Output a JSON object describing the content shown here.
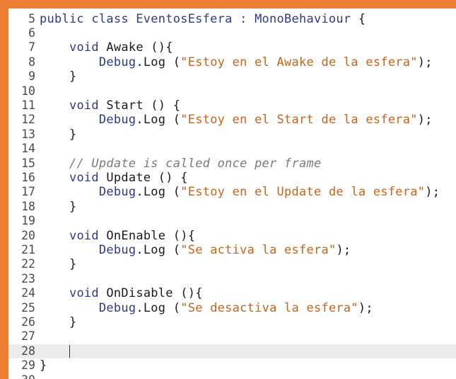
{
  "colors": {
    "border": "#ed7d31",
    "background": "#ffffff",
    "keyword": "#2b3a8c",
    "string": "#c7641b",
    "comment": "#7a7a7a",
    "current_line": "#ececec"
  },
  "editor": {
    "current_line": 28,
    "lines": [
      {
        "num": "5",
        "tokens": [
          {
            "t": "public class EventosEsfera : ",
            "c": "kw"
          },
          {
            "t": "MonoBehaviour",
            "c": "ty"
          },
          {
            "t": " {",
            "c": ""
          }
        ]
      },
      {
        "num": "6",
        "tokens": []
      },
      {
        "num": "7",
        "tokens": [
          {
            "t": "    ",
            "c": ""
          },
          {
            "t": "void",
            "c": "kw"
          },
          {
            "t": " Awake (){",
            "c": ""
          }
        ]
      },
      {
        "num": "8",
        "tokens": [
          {
            "t": "        ",
            "c": ""
          },
          {
            "t": "Debug",
            "c": "ty"
          },
          {
            "t": ".Log (",
            "c": ""
          },
          {
            "t": "\"Estoy en el Awake de la esfera\"",
            "c": "str"
          },
          {
            "t": ");",
            "c": ""
          }
        ]
      },
      {
        "num": "9",
        "tokens": [
          {
            "t": "    }",
            "c": ""
          }
        ]
      },
      {
        "num": "10",
        "tokens": []
      },
      {
        "num": "11",
        "tokens": [
          {
            "t": "    ",
            "c": ""
          },
          {
            "t": "void",
            "c": "kw"
          },
          {
            "t": " Start () {",
            "c": ""
          }
        ]
      },
      {
        "num": "12",
        "tokens": [
          {
            "t": "        ",
            "c": ""
          },
          {
            "t": "Debug",
            "c": "ty"
          },
          {
            "t": ".Log (",
            "c": ""
          },
          {
            "t": "\"Estoy en el Start de la esfera\"",
            "c": "str"
          },
          {
            "t": ");",
            "c": ""
          }
        ]
      },
      {
        "num": "13",
        "tokens": [
          {
            "t": "    }",
            "c": ""
          }
        ]
      },
      {
        "num": "14",
        "tokens": []
      },
      {
        "num": "15",
        "tokens": [
          {
            "t": "    ",
            "c": ""
          },
          {
            "t": "// Update is called once per frame",
            "c": "com"
          }
        ]
      },
      {
        "num": "16",
        "tokens": [
          {
            "t": "    ",
            "c": ""
          },
          {
            "t": "void",
            "c": "kw"
          },
          {
            "t": " Update () {",
            "c": ""
          }
        ]
      },
      {
        "num": "17",
        "tokens": [
          {
            "t": "        ",
            "c": ""
          },
          {
            "t": "Debug",
            "c": "ty"
          },
          {
            "t": ".Log (",
            "c": ""
          },
          {
            "t": "\"Estoy en el Update de la esfera\"",
            "c": "str"
          },
          {
            "t": ");",
            "c": ""
          }
        ]
      },
      {
        "num": "18",
        "tokens": [
          {
            "t": "    }",
            "c": ""
          }
        ]
      },
      {
        "num": "19",
        "tokens": []
      },
      {
        "num": "20",
        "tokens": [
          {
            "t": "    ",
            "c": ""
          },
          {
            "t": "void",
            "c": "kw"
          },
          {
            "t": " OnEnable (){",
            "c": ""
          }
        ]
      },
      {
        "num": "21",
        "tokens": [
          {
            "t": "        ",
            "c": ""
          },
          {
            "t": "Debug",
            "c": "ty"
          },
          {
            "t": ".Log (",
            "c": ""
          },
          {
            "t": "\"Se activa la esfera\"",
            "c": "str"
          },
          {
            "t": ");",
            "c": ""
          }
        ]
      },
      {
        "num": "22",
        "tokens": [
          {
            "t": "    }",
            "c": ""
          }
        ]
      },
      {
        "num": "23",
        "tokens": []
      },
      {
        "num": "24",
        "tokens": [
          {
            "t": "    ",
            "c": ""
          },
          {
            "t": "void",
            "c": "kw"
          },
          {
            "t": " OnDisable (){",
            "c": ""
          }
        ]
      },
      {
        "num": "25",
        "tokens": [
          {
            "t": "        ",
            "c": ""
          },
          {
            "t": "Debug",
            "c": "ty"
          },
          {
            "t": ".Log (",
            "c": ""
          },
          {
            "t": "\"Se desactiva la esfera\"",
            "c": "str"
          },
          {
            "t": ");",
            "c": ""
          }
        ]
      },
      {
        "num": "26",
        "tokens": [
          {
            "t": "    }",
            "c": ""
          }
        ]
      },
      {
        "num": "27",
        "tokens": []
      },
      {
        "num": "28",
        "tokens": [
          {
            "t": "    ",
            "c": ""
          }
        ]
      },
      {
        "num": "29",
        "tokens": [
          {
            "t": "}",
            "c": ""
          }
        ]
      },
      {
        "num": "30",
        "tokens": []
      }
    ]
  }
}
